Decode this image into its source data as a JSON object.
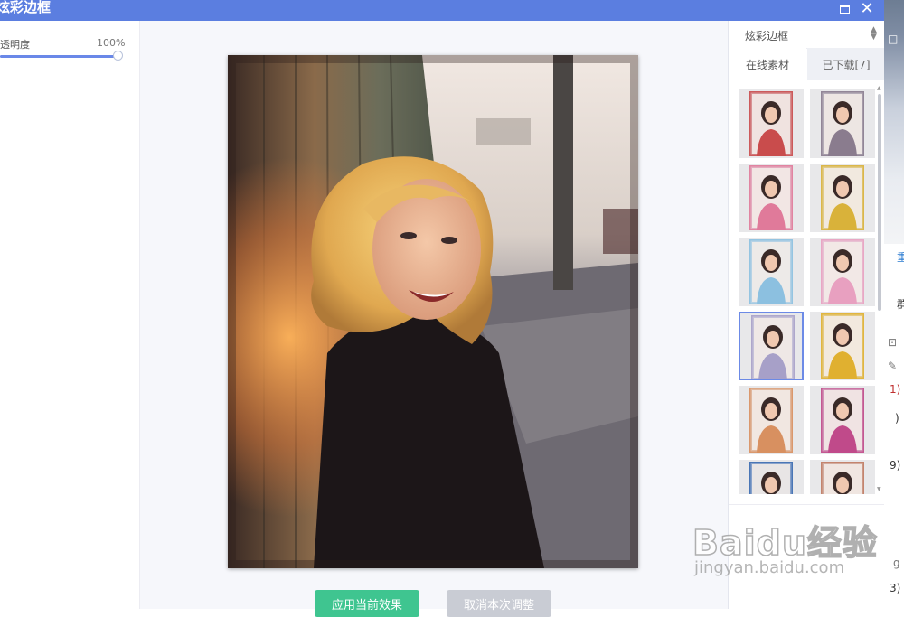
{
  "window": {
    "title": "炫彩边框",
    "close_symbol": "✕"
  },
  "left_panel": {
    "opacity_label": "透明度",
    "opacity_value": "100%",
    "opacity_fraction": 1.0
  },
  "canvas": {
    "apply_button": "应用当前效果",
    "cancel_button": "取消本次调整"
  },
  "right_panel": {
    "category_select": {
      "selected": "炫彩边框",
      "arrow_up": "▲",
      "arrow_down": "▼"
    },
    "tabs": [
      {
        "label": "在线素材",
        "active": true
      },
      {
        "label": "已下载[7]",
        "active": false
      }
    ],
    "thumbnails": [
      {
        "selected": false,
        "frame_color": "#c94c4c"
      },
      {
        "selected": false,
        "frame_color": "#8a7c8e"
      },
      {
        "selected": false,
        "frame_color": "#e07a9a"
      },
      {
        "selected": false,
        "frame_color": "#d9b23a"
      },
      {
        "selected": false,
        "frame_color": "#8cc0e0"
      },
      {
        "selected": false,
        "frame_color": "#e8a0c0"
      },
      {
        "selected": true,
        "frame_color": "#a7a0c8"
      },
      {
        "selected": false,
        "frame_color": "#e0b030"
      },
      {
        "selected": false,
        "frame_color": "#d89060"
      },
      {
        "selected": false,
        "frame_color": "#c04a8a"
      },
      {
        "selected": false,
        "frame_color": "#3a6ab0"
      },
      {
        "selected": false,
        "frame_color": "#c07a60"
      }
    ],
    "scroll_up": "▲",
    "scroll_down": "▼"
  },
  "background_app": {
    "glyphs": [
      "□",
      "重",
      "群",
      "⊡",
      "✎",
      "1)",
      ")",
      "9)",
      "g",
      "3)"
    ]
  },
  "watermark": {
    "brand": "Baidu经验",
    "sub": "jingyan.baidu.com"
  },
  "colors": {
    "titlebar": "#5b7ee0",
    "apply": "#3fc590",
    "cancel": "#c9ccd4",
    "accent": "#6c8ae6"
  }
}
